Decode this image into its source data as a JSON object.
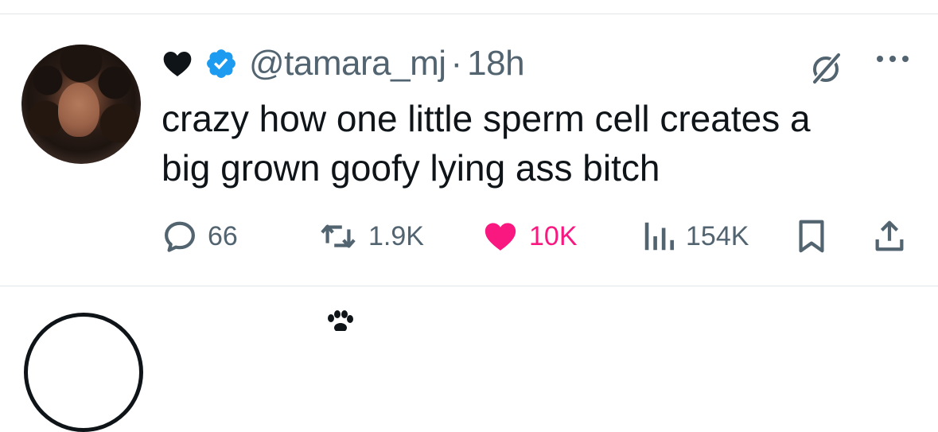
{
  "tweet": {
    "name_emoji": "black-heart",
    "verified": true,
    "handle": "@tamara_mj",
    "separator": "·",
    "time": "18h",
    "text_lines": [
      "crazy how one little sperm cell creates a",
      "big grown goofy lying ass bitch"
    ]
  },
  "actions": {
    "replies": "66",
    "reposts": "1.9K",
    "likes": "10K",
    "views": "154K"
  },
  "colors": {
    "verified_blue": "#1d9bf0",
    "like_pink": "#f91880",
    "secondary_text": "#536471",
    "primary_text": "#0f1419"
  }
}
